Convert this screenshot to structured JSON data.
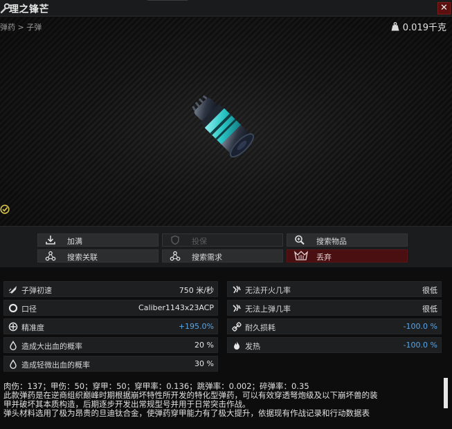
{
  "window": {
    "title": "理之锋芒",
    "close_label": "✕"
  },
  "preview": {
    "breadcrumb": "弹药 > 子弹",
    "weight": "0.019千克"
  },
  "actions": [
    {
      "label": "加满",
      "icon": "download-icon",
      "enabled": true
    },
    {
      "label": "投保",
      "icon": "shield-icon",
      "enabled": false
    },
    {
      "label": "搜索物品",
      "icon": "magnifier-icon",
      "enabled": true
    },
    {
      "label": "搜索关联",
      "icon": "nodes-icon",
      "enabled": true
    },
    {
      "label": "搜索需求",
      "icon": "nodes-icon",
      "enabled": true
    },
    {
      "label": "丢弃",
      "icon": "trash-icon",
      "enabled": true,
      "style": "danger"
    }
  ],
  "stats_left": [
    {
      "name": "子弹初速",
      "value": "750 米/秒",
      "icon": "bullet-speed-icon"
    },
    {
      "name": "口径",
      "value": "Caliber1143x23ACP",
      "icon": "caliber-icon"
    },
    {
      "name": "精准度",
      "value": "+195.0%",
      "icon": "crosshair-icon",
      "highlight": true
    },
    {
      "name": "造成大出血的概率",
      "value": "20 %",
      "icon": "blood-drop-icon"
    },
    {
      "name": "造成轻微出血的概率",
      "value": "30 %",
      "icon": "blood-drop-icon"
    }
  ],
  "stats_right": [
    {
      "name": "无法开火几率",
      "value": "很低",
      "icon": "misfire-icon"
    },
    {
      "name": "无法上弹几率",
      "value": "很低",
      "icon": "misfeed-icon"
    },
    {
      "name": "耐久损耗",
      "value": "-100.0 %",
      "icon": "durability-icon",
      "highlight": true
    },
    {
      "name": "发热",
      "value": "-100.0 %",
      "icon": "flame-icon",
      "highlight": true
    }
  ],
  "description": {
    "line1": "肉伤：137；甲伤：50；穿甲：50；穿甲率：0.136；跳弹率：0.002；碎弹率：0.35",
    "line2": "此款弹药是在逆商组织巅峰时期根据崩坏特性所开发的特化型弹药，可以有效穿透弩炮级及以下崩坏兽的装",
    "line3": "甲并破坏其本质构造，后期逐步开发出常规型号并用于日常突击作战。",
    "line4": "弹头材料选用了极为昂贵的旦迪钛合金，使弹药穿甲能力有了极大提升，依据现有作战记录和行动数据表"
  },
  "colors": {
    "accent_blue": "#5aa6e8",
    "danger_red": "#4a0f10",
    "ammo_teal": "#29c4c4"
  }
}
